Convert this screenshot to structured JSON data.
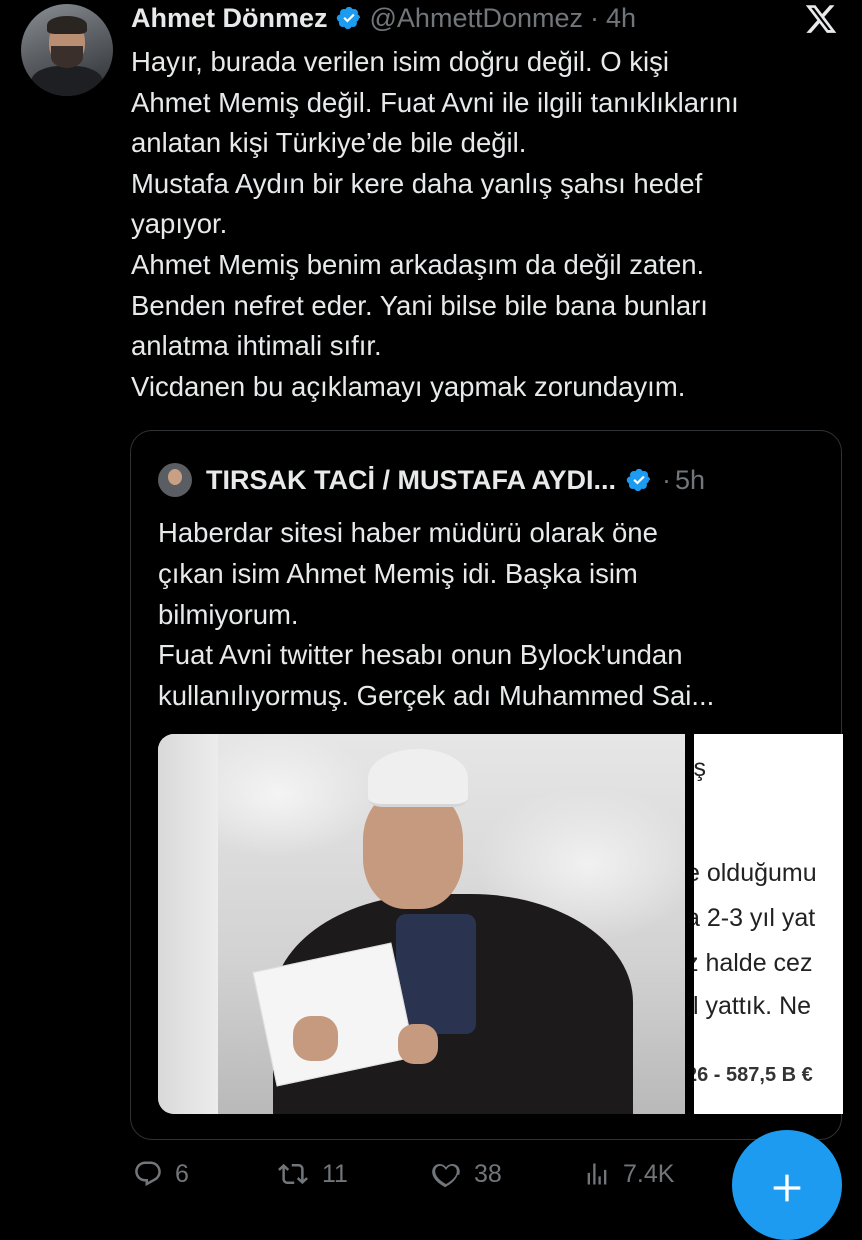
{
  "author": {
    "name": "Ahmet Dönmez",
    "handle": "@AhmettDonmez",
    "separator": "·",
    "time": "4h",
    "avatar_icon": "profile-photo"
  },
  "platform_icon": "x-logo-icon",
  "tweet_lines": [
    "Hayır, burada verilen isim doğru değil. O kişi",
    "Ahmet Memiş değil. Fuat Avni ile ilgili tanıklıklarını",
    "anlatan kişi Türkiye’de bile değil.",
    "Mustafa Aydın bir kere daha yanlış şahsı hedef",
    "yapıyor.",
    "Ahmet Memiş benim arkadaşım da değil zaten.",
    "Benden nefret eder. Yani bilse bile bana bunları",
    "anlatma ihtimali sıfır.",
    "Vicdanen bu açıklamayı yapmak zorundayım."
  ],
  "quoted": {
    "name": "TIRSAK TACİ / MUSTAFA AYDI...",
    "separator": "·",
    "time": "5h",
    "lines": [
      "Haberdar sitesi haber müdürü olarak öne",
      "çıkan isim Ahmet Memiş idi. Başka isim",
      "bilmiyorum.",
      "Fuat Avni twitter hesabı onun Bylock'undan",
      "kullanılıyormuş. Gerçek adı Muhammed Sai..."
    ],
    "media2_lines": [
      "iş",
      "e olduğumu",
      "a 2-3 yıl yat",
      "z halde cez",
      "ıl yattık. Ne",
      "26 - 587,5 B €"
    ]
  },
  "actions": {
    "replies": "6",
    "retweets": "11",
    "likes": "38",
    "views": "7.4K"
  },
  "colors": {
    "background": "#000000",
    "text": "#e7e9ea",
    "muted": "#71767b",
    "accent": "#1d9bf0",
    "border": "#2f3336"
  }
}
